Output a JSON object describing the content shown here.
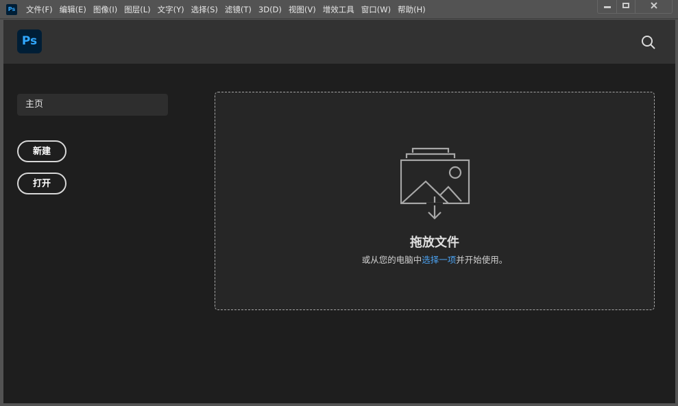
{
  "titlebar": {
    "app_icon": "Ps",
    "menu": [
      "文件(F)",
      "编辑(E)",
      "图像(I)",
      "图层(L)",
      "文字(Y)",
      "选择(S)",
      "滤镜(T)",
      "3D(D)",
      "视图(V)",
      "增效工具",
      "窗口(W)",
      "帮助(H)"
    ]
  },
  "header": {
    "logo": "Ps"
  },
  "sidebar": {
    "home": "主页",
    "new": "新建",
    "open": "打开"
  },
  "dropzone": {
    "title": "拖放文件",
    "sub_prefix": "或从您的电脑中",
    "sub_link": "选择一项",
    "sub_suffix": "并开始使用。"
  },
  "colors": {
    "accent": "#4ba1f0",
    "brand": "#31a8ff"
  }
}
